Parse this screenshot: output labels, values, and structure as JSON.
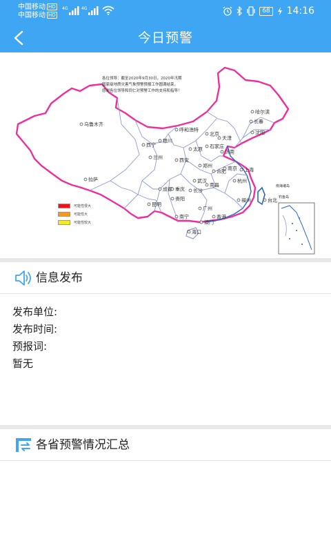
{
  "status_bar": {
    "carrier1": "中国移动",
    "carrier2": "中国移动",
    "hd_badge": "HD",
    "network_badge": "4G",
    "battery": "68",
    "time": "14:16"
  },
  "header": {
    "title": "今日预警"
  },
  "map": {
    "note_lines": [
      "各位领导：截至2020年9月30日，2020年汛期",
      "国家级地质灾害气象预警预报工作圆满结束，",
      "感谢各位领导和同仁对预警工作的支持和指导！"
    ],
    "legend": [
      {
        "label": "可能性很大",
        "color": "#e8141c"
      },
      {
        "label": "可能性大",
        "color": "#f39a25"
      },
      {
        "label": "可能性较大",
        "color": "#f4ea2a"
      }
    ],
    "cities": [
      "乌鲁木齐",
      "哈尔滨",
      "长春",
      "沈阳",
      "呼和浩特",
      "北京",
      "天津",
      "银川",
      "太原",
      "石家庄",
      "济南",
      "西宁",
      "兰州",
      "郑州",
      "西安",
      "合肥",
      "南京",
      "上海",
      "拉萨",
      "成都",
      "武汉",
      "杭州",
      "重庆",
      "长沙",
      "南昌",
      "福州",
      "贵阳",
      "台北",
      "昆明",
      "南宁",
      "广州",
      "香港",
      "澳门",
      "海口"
    ],
    "inset_labels": [
      "南海诸岛",
      "钓鱼岛"
    ]
  },
  "info_section": {
    "title": "信息发布",
    "publisher_label": "发布单位:",
    "publisher_value": "",
    "time_label": "发布时间:",
    "time_value": "",
    "forecast_label": "预报词:",
    "forecast_value": "",
    "empty_text": "暂无"
  },
  "summary_section": {
    "title": "各省预警情况汇总"
  },
  "colors": {
    "primary": "#3ea6f2",
    "border_pink": "#ee2f9b",
    "province_line": "#8e9ad0",
    "coast_blue": "#2a63c9"
  },
  "icons": {
    "back": "chevron-left-icon",
    "speaker": "speaker-icon",
    "summary": "list-refresh-icon"
  }
}
